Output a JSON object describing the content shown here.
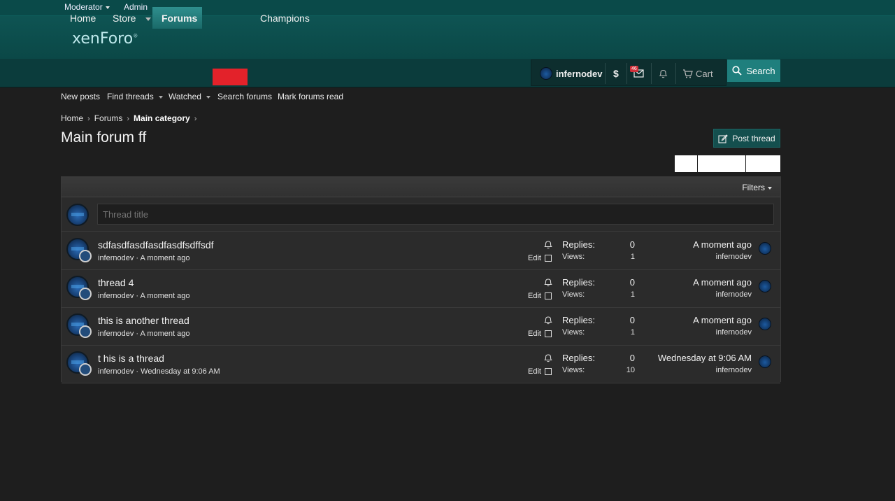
{
  "staffbar": {
    "moderator": "Moderator",
    "admin": "Admin"
  },
  "logo": {
    "text": "xenForo",
    "mark": "®"
  },
  "nav": {
    "tabs": [
      "Home",
      "Store",
      "Forums",
      "Champions"
    ],
    "selected": "Forums"
  },
  "user": {
    "name": "infernodev",
    "currency_symbol": "$",
    "inbox_count": "46",
    "cart_label": "Cart",
    "search_label": "Search"
  },
  "subnav": [
    "New posts",
    "Find threads",
    "Watched",
    "Search forums",
    "Mark forums read"
  ],
  "breadcrumb": [
    "Home",
    "Forums",
    "Main category"
  ],
  "page": {
    "title": "Main forum ff",
    "post_thread": "Post thread"
  },
  "filters": {
    "label": "Filters"
  },
  "quick_thread": {
    "placeholder": "Thread title"
  },
  "threads": [
    {
      "title": "sdfasdfasdfasdfasdfsdffsdf",
      "author": "infernodev",
      "date": "A moment ago",
      "replies_label": "Replies:",
      "replies": "0",
      "views_label": "Views:",
      "views": "1",
      "last_time": "A moment ago",
      "last_user": "infernodev",
      "edit": "Edit"
    },
    {
      "title": "thread 4",
      "author": "infernodev",
      "date": "A moment ago",
      "replies_label": "Replies:",
      "replies": "0",
      "views_label": "Views:",
      "views": "1",
      "last_time": "A moment ago",
      "last_user": "infernodev",
      "edit": "Edit"
    },
    {
      "title": "this is another thread",
      "author": "infernodev",
      "date": "A moment ago",
      "replies_label": "Replies:",
      "replies": "0",
      "views_label": "Views:",
      "views": "1",
      "last_time": "A moment ago",
      "last_user": "infernodev",
      "edit": "Edit"
    },
    {
      "title": "t his is a thread",
      "author": "infernodev",
      "date": "Wednesday at 9:06 AM",
      "replies_label": "Replies:",
      "replies": "0",
      "views_label": "Views:",
      "views": "10",
      "last_time": "Wednesday at 9:06 AM",
      "last_user": "infernodev",
      "edit": "Edit"
    }
  ],
  "meta_separator": " · ",
  "colors": {
    "header": "#0b4847",
    "accent": "#1f7f7d",
    "background": "#1e1e1e",
    "red_box": "#e3222a"
  }
}
